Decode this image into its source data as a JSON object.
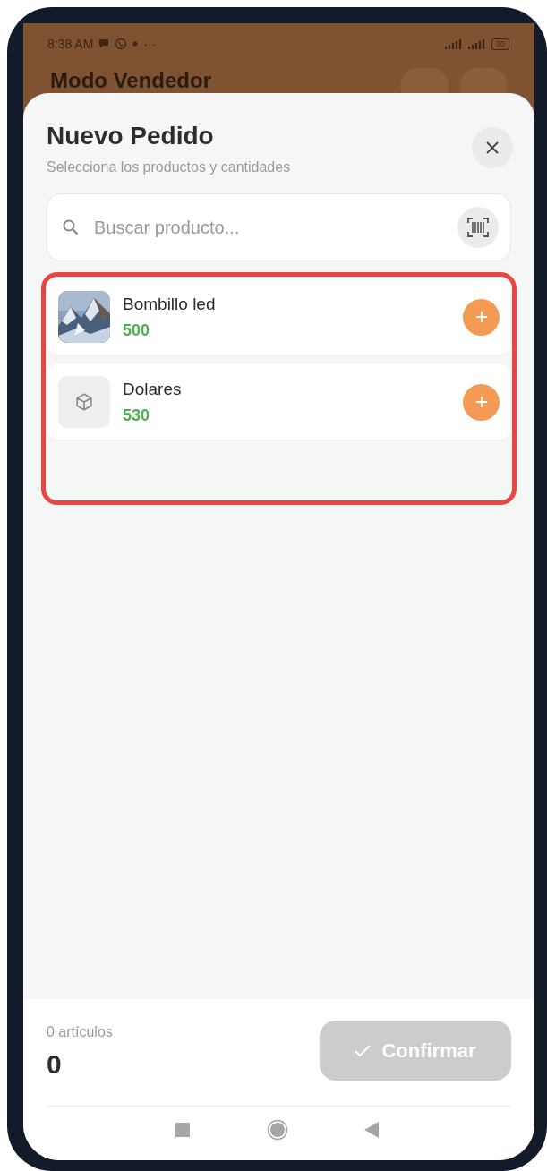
{
  "status_bar": {
    "time": "8:38 AM",
    "more": "···",
    "battery": "30"
  },
  "app_header": {
    "title": "Modo Vendedor"
  },
  "sheet": {
    "title": "Nuevo Pedido",
    "subtitle": "Selecciona los productos y cantidades",
    "search": {
      "placeholder": "Buscar producto..."
    },
    "highlighted": true,
    "products": [
      {
        "name": "Bombillo led",
        "price": "500"
      },
      {
        "name": "Dolares",
        "price": "530",
        "kind": "placeholder"
      }
    ],
    "footer": {
      "count_label": "0 artículos",
      "total": "0",
      "confirm": {
        "label": "Confirmar",
        "disabled": true
      }
    }
  }
}
